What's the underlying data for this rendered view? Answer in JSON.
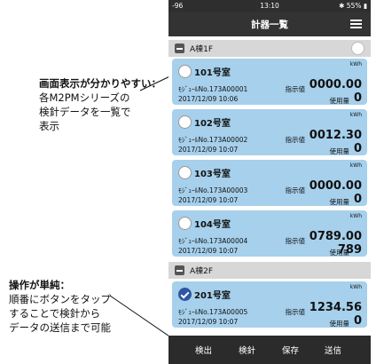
{
  "annotations": [
    {
      "lines": [
        "画面表示が分かりやすい：",
        "各M2PMシリーズの",
        "検針データを一覧で",
        "表示"
      ]
    },
    {
      "lines": [
        "操作が単純：",
        "順番にボタンをタップ",
        "することで検針から",
        "データの送信まで可能"
      ]
    }
  ],
  "status": {
    "left": "-96",
    "time": "13:10",
    "right": "✱ 55% ▮"
  },
  "nav": {
    "title": "計器一覧",
    "menu_icon": "hamburger-menu-icon"
  },
  "groups": [
    {
      "label": "A棟1F"
    },
    {
      "label": "A棟2F"
    }
  ],
  "meters": [
    {
      "room": "101号室",
      "module": "ﾓｼﾞｭｰﾙNo.173A00001",
      "date": "2017/12/09 10:06",
      "unit": "kWh",
      "indicator_label": "指示値",
      "indicator": "0000.00",
      "usage_label": "使用量",
      "usage": "0",
      "checked": false
    },
    {
      "room": "102号室",
      "module": "ﾓｼﾞｭｰﾙNo.173A00002",
      "date": "2017/12/09 10:07",
      "unit": "kWh",
      "indicator_label": "指示値",
      "indicator": "0012.30",
      "usage_label": "使用量",
      "usage": "0",
      "checked": false
    },
    {
      "room": "103号室",
      "module": "ﾓｼﾞｭｰﾙNo.173A00003",
      "date": "2017/12/09 10:07",
      "unit": "kWh",
      "indicator_label": "指示値",
      "indicator": "0000.00",
      "usage_label": "使用量",
      "usage": "0",
      "checked": false
    },
    {
      "room": "104号室",
      "module": "ﾓｼﾞｭｰﾙNo.173A00004",
      "date": "2017/12/09 10:07",
      "unit": "kWh",
      "indicator_label": "指示値",
      "indicator": "0789.00",
      "usage_label": "使用量",
      "usage": "789",
      "checked": false
    },
    {
      "room": "201号室",
      "module": "ﾓｼﾞｭｰﾙNo.173A00005",
      "date": "2017/12/09 10:07",
      "unit": "kWh",
      "indicator_label": "指示値",
      "indicator": "1234.56",
      "usage_label": "使用量",
      "usage": "0",
      "checked": true
    }
  ],
  "tabs": [
    {
      "label": "検出"
    },
    {
      "label": "検針"
    },
    {
      "label": "保存"
    },
    {
      "label": "送信"
    }
  ]
}
